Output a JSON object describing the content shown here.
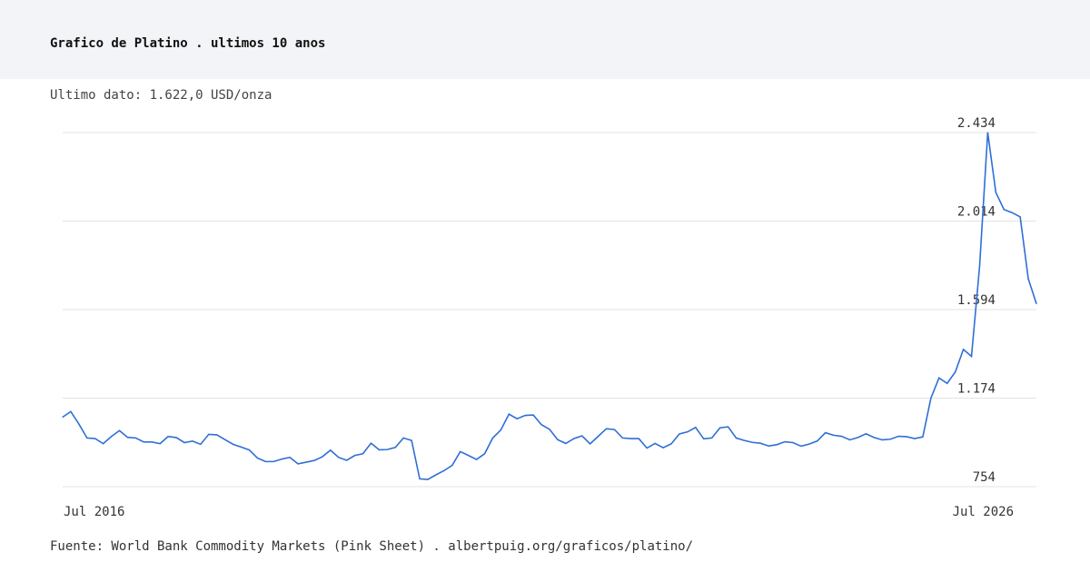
{
  "header": {
    "title": "Grafico de Platino . ultimos 10 anos",
    "subtitle": "Ultimo dato: 1.622,0 USD/onza"
  },
  "footer": {
    "source": "Fuente: World Bank Commodity Markets (Pink Sheet) . albertpuig.org/graficos/platino/"
  },
  "colors": {
    "line": "#2f6fd6",
    "grid": "#e3e3e3",
    "header_bg": "#f3f4f7"
  },
  "chart_data": {
    "type": "line",
    "xlabel": "",
    "ylabel": "",
    "ylim": [
      754,
      2434
    ],
    "yticks": [
      2434,
      2014,
      1594,
      1174,
      754
    ],
    "ytick_labels": [
      "2.434",
      "2.014",
      "1.594",
      "1.174",
      "754"
    ],
    "xtick_labels": [
      "Jul 2016",
      "Jul 2026"
    ],
    "grid": true,
    "series": [
      {
        "values": [
          1084,
          1110,
          1051,
          985,
          982,
          958,
          992,
          1020,
          988,
          985,
          966,
          966,
          958,
          992,
          987,
          963,
          970,
          955,
          1002,
          1000,
          977,
          955,
          942,
          928,
          890,
          873,
          873,
          885,
          893,
          862,
          870,
          878,
          896,
          927,
          893,
          879,
          902,
          910,
          960,
          929,
          930,
          940,
          985,
          973,
          791,
          788,
          810,
          830,
          855,
          920,
          902,
          883,
          910,
          985,
          1023,
          1098,
          1076,
          1092,
          1094,
          1048,
          1026,
          977,
          959,
          982,
          995,
          957,
          993,
          1029,
          1025,
          985,
          982,
          982,
          937,
          959,
          939,
          957,
          1004,
          1014,
          1035,
          981,
          985,
          1033,
          1038,
          985,
          973,
          964,
          960,
          947,
          953,
          967,
          963,
          946,
          956,
          971,
          1010,
          998,
          993,
          976,
          987,
          1005,
          987,
          976,
          979,
          993,
          991,
          982,
          990,
          1174,
          1270,
          1244,
          1298,
          1405,
          1372,
          1800,
          2434,
          2150,
          2069,
          2054,
          2034,
          1740,
          1622
        ]
      }
    ]
  }
}
